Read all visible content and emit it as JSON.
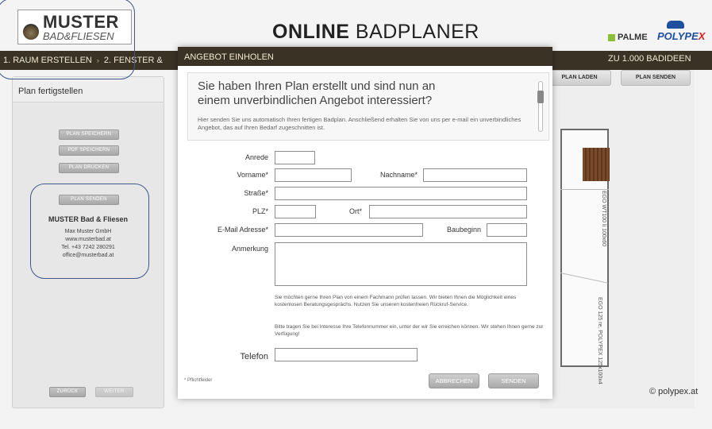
{
  "header": {
    "logo_line1": "MUSTER",
    "logo_line2": "BAD&FLIESEN",
    "title_bold": "ONLINE",
    "title_rest": "BADPLANER",
    "brand_palme": "PALME",
    "brand_polypex": "POLYPE",
    "brand_polypex_x": "X"
  },
  "nav": {
    "steps": [
      "1. RAUM ERSTELLEN",
      "2. FENSTER &"
    ],
    "separator": "›",
    "ideas": "ZU 1.000 BADIDEEN"
  },
  "left_panel": {
    "title": "Plan fertigstellen",
    "buttons": {
      "plan_speichern": "PLAN SPEICHERN",
      "pdf_speichern": "PDF SPEICHERN",
      "plan_drucken": "PLAN DRUCKEN",
      "plan_senden": "PLAN SENDEN",
      "zurueck": "ZURÜCK",
      "weiter": "WEITER"
    },
    "company": "MUSTER Bad & Fliesen",
    "contact_person": "Max Muster GmbH",
    "contact_web": "www.musterbad.at",
    "contact_tel": "Tel. +43 7242 280291",
    "contact_mail": "office@musterbad.at"
  },
  "right_panel": {
    "plan_laden": "PLAN LADEN",
    "plan_senden": "PLAN SENDEN",
    "fp_label_wt": "EGO WT100 li 100x60",
    "fp_label_ego": "EGO 125 re. POLYPEX 125x100x4",
    "copyright": "© polypex.at"
  },
  "modal": {
    "title": "ANGEBOT EINHOLEN",
    "headline": "Sie haben Ihren Plan erstellt und sind nun an einem unverbindlichen Angebot interessiert?",
    "intro_text": "Hier senden Sie uns automatisch Ihren fertigen Badplan. Anschließend erhalten Sie von uns per e-mail ein unverbindliches Angebot, das auf Ihren Bedarf zugeschnitten ist.",
    "labels": {
      "anrede": "Anrede",
      "vorname": "Vorname*",
      "nachname": "Nachname*",
      "strasse": "Straße*",
      "plz": "PLZ*",
      "ort": "Ort*",
      "email": "E-Mail Adresse*",
      "baubeginn": "Baubeginn",
      "anmerkung": "Anmerkung",
      "telefon": "Telefon"
    },
    "values": {
      "anrede": "",
      "vorname": "",
      "nachname": "",
      "strasse": "",
      "plz": "",
      "ort": "",
      "email": "",
      "baubeginn": "",
      "anmerkung": "",
      "telefon": ""
    },
    "info1": "Sie möchten gerne Ihren Plan von einem Fachmann prüfen lassen. Wir bieten Ihnen die Möglichkeit eines kostenlosen Beratungsgesprächs. Nutzen Sie unseren kostenfreien Rückruf-Service.",
    "info2": "Bitte tragen Sie bei Interesse Ihre Telefonnummer ein, unter der wir Sie erreichen können. Wir stehen Ihnen gerne zur Verfügung!",
    "required_note": "* Pflichtfelder",
    "cancel": "ABBRECHEN",
    "send": "SENDEN"
  },
  "colors": {
    "nav_bg": "#3b3226",
    "nav_text": "#f0e6d2",
    "highlight": "#40588a",
    "palme_green": "#8bbf3a",
    "polypex_blue": "#1e4f9e"
  }
}
